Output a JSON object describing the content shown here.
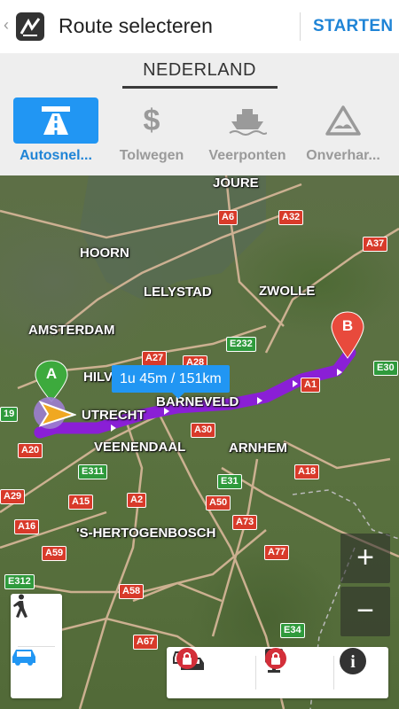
{
  "header": {
    "title": "Route selecteren",
    "start_label": "STARTEN",
    "back_icon": "chevron-left-icon",
    "logo_icon": "navigation-app-icon"
  },
  "country": "NEDERLAND",
  "avoid_options": [
    {
      "label": "Autosnel...",
      "icon": "highway-icon",
      "active": true
    },
    {
      "label": "Tolwegen",
      "icon": "dollar-icon",
      "active": false
    },
    {
      "label": "Veerponten",
      "icon": "ferry-icon",
      "active": false
    },
    {
      "label": "Onverhar...",
      "icon": "unpaved-road-icon",
      "active": false
    }
  ],
  "map": {
    "cities": [
      "JOURE",
      "HOORN",
      "LELYSTAD",
      "ZWOLLE",
      "AMSTERDAM",
      "HILV",
      "UTRECHT",
      "BARNEVELD",
      "VEENENDAAL",
      "ARNHEM",
      "'S-HERTOGENBOSCH"
    ],
    "road_shields": [
      "A6",
      "A32",
      "A37",
      "E232",
      "A27",
      "A28",
      "A1",
      "E30",
      "19",
      "A20",
      "A30",
      "E311",
      "A2",
      "E31",
      "A18",
      "A29",
      "A15",
      "A50",
      "A16",
      "A73",
      "A59",
      "A77",
      "E312",
      "A58",
      "E34",
      "A67"
    ],
    "route_info": "1u 45m / 151km",
    "start_marker": "A",
    "end_marker": "B",
    "route_color": "#8a1fd6"
  },
  "controls": {
    "zoom_in": "+",
    "zoom_out": "−",
    "mode_walk_icon": "pedestrian-icon",
    "mode_car_icon": "car-icon",
    "traffic_icon": "traffic-icon",
    "speed_camera_icon": "speed-camera-icon",
    "lock_icon": "lock-icon",
    "info_icon": "info-icon",
    "info_glyph": "i"
  },
  "colors": {
    "accent": "#2196f3",
    "accent_text": "#1f84d6",
    "lock_red": "#d32f3a"
  }
}
